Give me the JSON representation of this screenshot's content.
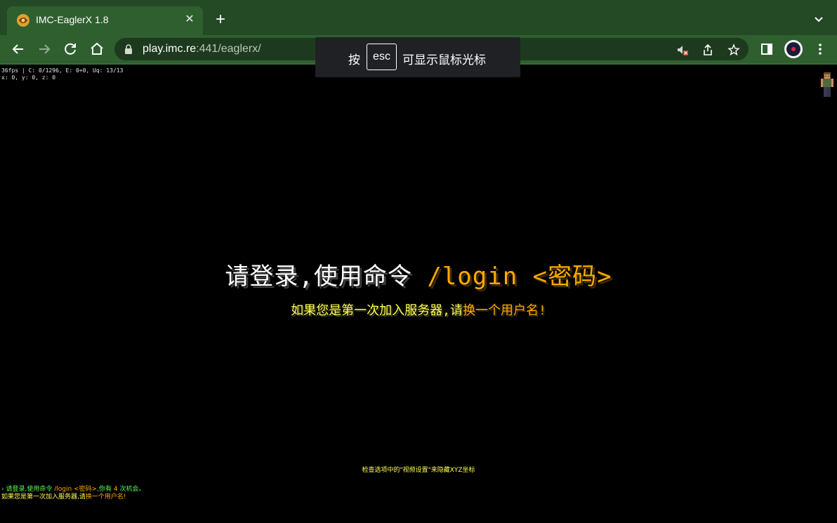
{
  "browser": {
    "tab_title": "IMC-EaglerX 1.8",
    "tab_close": "✕",
    "new_tab": "+",
    "url_host": "play.imc.re",
    "url_rest": ":441/eaglerx/"
  },
  "esc_toast": {
    "pre": "按",
    "key": "esc",
    "post": "可显示鼠标光标"
  },
  "game": {
    "debug_line1": "36fps | C: 0/1296, E: 0+0, Uq: 13/13",
    "debug_line2": "x: 0, y: 0, z: 0",
    "title_main": "请登录,使用命令 ",
    "title_cmd": "/login <密码>",
    "subtitle_main": "如果您是第一次加入服务器,请",
    "subtitle_acc": "换一个用户名!",
    "hint": "检查选项中的\"视频设置\"来隐藏XYZ坐标",
    "chat": [
      {
        "arrow": "›",
        "part1": " 请登录,使用命令 ",
        "part2": "/login <密码>",
        "part3": ",你有 ",
        "part4": "4",
        "part5": " 次机会。"
      },
      {
        "part1": "如果您是第一次加入服务器,请",
        "part2": "换一个用户名!"
      }
    ]
  },
  "colors": {
    "chrome_dark": "#234a24",
    "chrome_tab": "#2f5f2f",
    "text_gold": "#ffaa00",
    "text_yellow": "#ffff55",
    "text_green": "#55ff55"
  }
}
